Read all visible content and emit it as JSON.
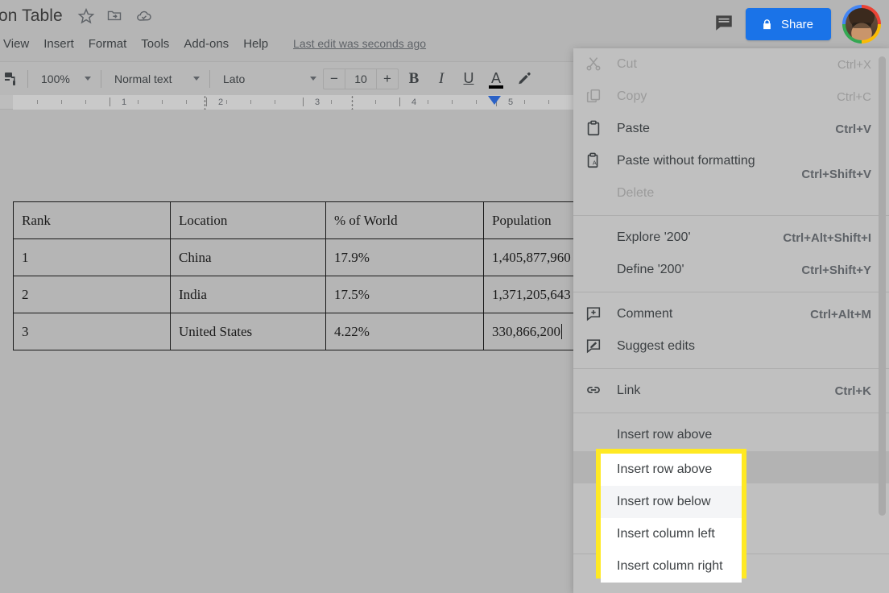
{
  "document": {
    "title": "on Table",
    "icons": [
      "star-icon",
      "move-to-folder-icon",
      "cloud-saved-icon"
    ]
  },
  "menubar": {
    "items": [
      "View",
      "Insert",
      "Format",
      "Tools",
      "Add-ons",
      "Help"
    ],
    "last_edit": "Last edit was seconds ago"
  },
  "toolbar": {
    "paint_format": "paint-format-icon",
    "zoom": "100%",
    "paragraph_style": "Normal text",
    "font": "Lato",
    "font_size": "10",
    "decrease_label": "−",
    "increase_label": "+",
    "bold": "B",
    "italic": "I",
    "underline": "U",
    "text_color": "A",
    "highlight": "highlight-pen-icon"
  },
  "ruler": {
    "numbers": [
      "1",
      "2",
      "3",
      "4",
      "5"
    ],
    "indent_marker_position": "5"
  },
  "topright": {
    "comment_history": "comment-history-icon",
    "share_label": "Share",
    "share_color": "#1a73e8",
    "avatar": "user-avatar"
  },
  "table": {
    "headers": [
      "Rank",
      "Location",
      "% of World",
      "Population"
    ],
    "rows": [
      [
        "1",
        "China",
        "17.9%",
        "1,405,877,960"
      ],
      [
        "2",
        "India",
        "17.5%",
        "1,371,205,643"
      ],
      [
        "3",
        "United States",
        "4.22%",
        "330,866,200"
      ]
    ]
  },
  "context_menu": {
    "groups": [
      {
        "items": [
          {
            "icon": "cut-icon",
            "label": "Cut",
            "shortcut": "Ctrl+X",
            "disabled": true
          },
          {
            "icon": "copy-icon",
            "label": "Copy",
            "shortcut": "Ctrl+C",
            "disabled": true
          },
          {
            "icon": "paste-icon",
            "label": "Paste",
            "shortcut": "Ctrl+V",
            "disabled": false
          },
          {
            "icon": "paste-plain-icon",
            "label": "Paste without formatting",
            "shortcut": "Ctrl+Shift+V",
            "disabled": false
          },
          {
            "icon": "none",
            "label": "Delete",
            "shortcut": "",
            "disabled": true
          }
        ]
      },
      {
        "items": [
          {
            "icon": "none",
            "label": "Explore '200'",
            "shortcut": "Ctrl+Alt+Shift+I",
            "disabled": false
          },
          {
            "icon": "none",
            "label": "Define '200'",
            "shortcut": "Ctrl+Shift+Y",
            "disabled": false
          }
        ]
      },
      {
        "items": [
          {
            "icon": "comment-icon",
            "label": "Comment",
            "shortcut": "Ctrl+Alt+M",
            "disabled": false
          },
          {
            "icon": "suggest-edits-icon",
            "label": "Suggest edits",
            "shortcut": "",
            "disabled": false
          }
        ]
      },
      {
        "items": [
          {
            "icon": "link-icon",
            "label": "Link",
            "shortcut": "Ctrl+K",
            "disabled": false
          }
        ]
      },
      {
        "items": [
          {
            "icon": "none",
            "label": "Insert row above",
            "shortcut": "",
            "disabled": false
          },
          {
            "icon": "none",
            "label": "Insert row below",
            "shortcut": "",
            "disabled": false,
            "hovered": true
          },
          {
            "icon": "none",
            "label": "Insert column left",
            "shortcut": "",
            "disabled": false
          },
          {
            "icon": "none",
            "label": "Insert column right",
            "shortcut": "",
            "disabled": false
          }
        ]
      }
    ]
  },
  "callout": {
    "border_color": "#ffe923",
    "items": [
      {
        "label": "Insert row above",
        "hovered": false
      },
      {
        "label": "Insert row below",
        "hovered": true
      },
      {
        "label": "Insert column left",
        "hovered": false
      },
      {
        "label": "Insert column right",
        "hovered": false
      }
    ]
  }
}
